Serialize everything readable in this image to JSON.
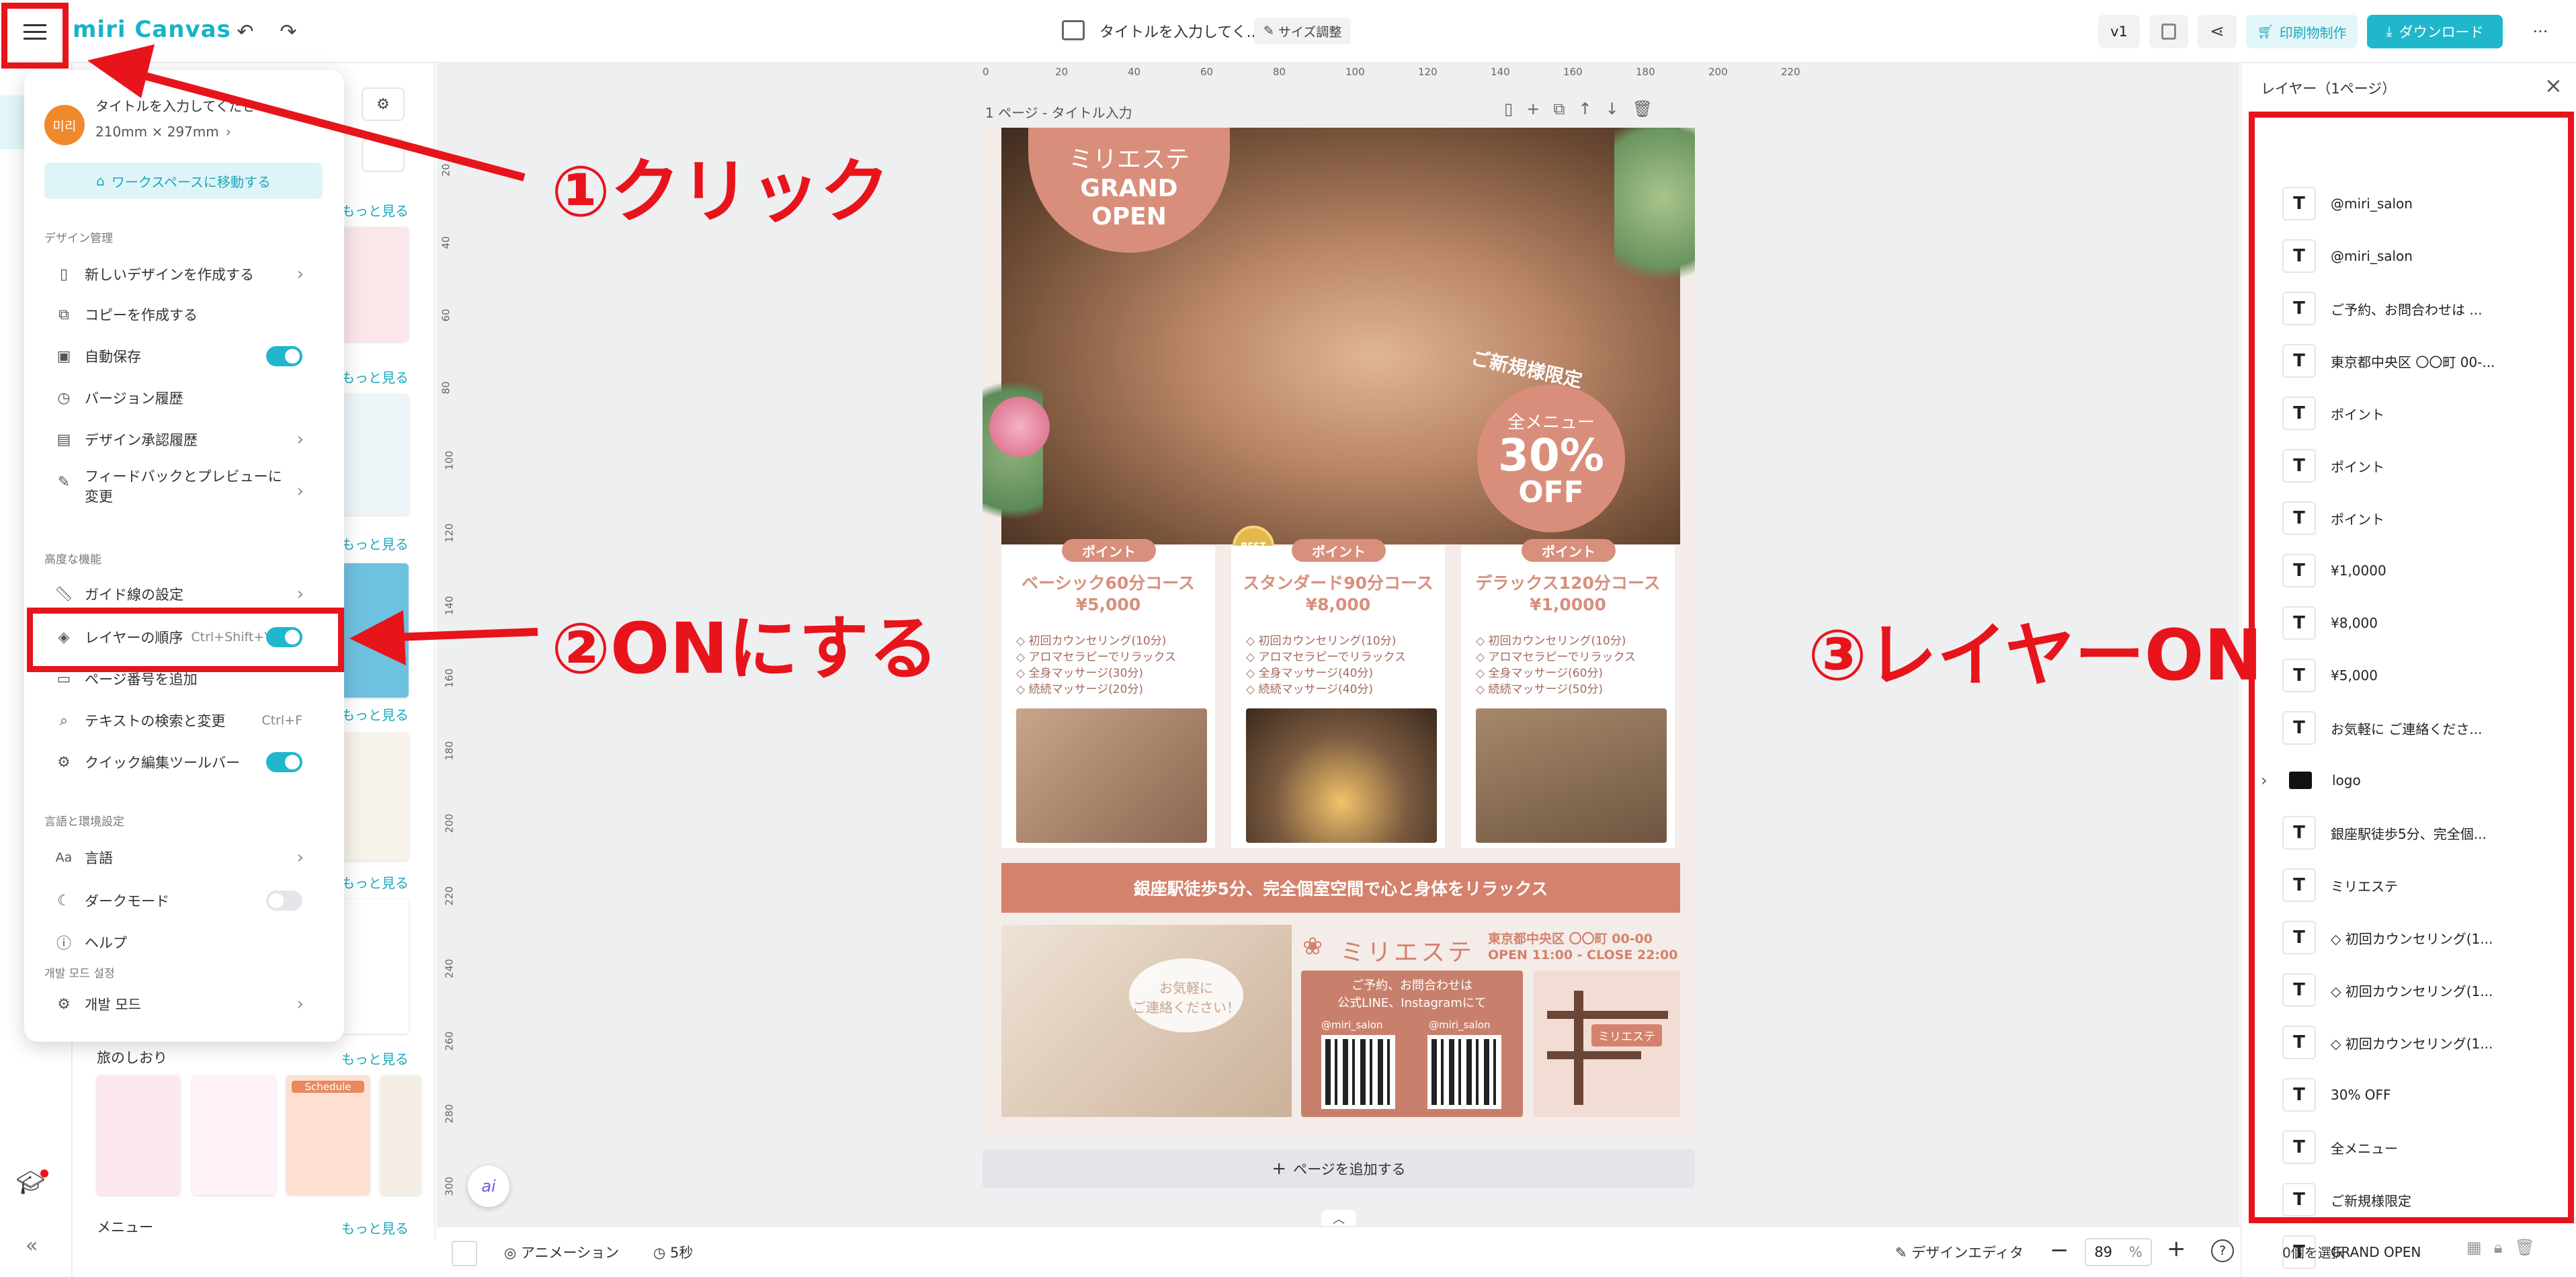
{
  "app": {
    "logo": "miri Canvas"
  },
  "topbar": {
    "doc_title": "タイトルを入力してく...",
    "size_adjust": "サイズ調整",
    "version": "v1",
    "print_label": "印刷物制作",
    "download_label": "ダウンロード",
    "more": "···"
  },
  "menu": {
    "avatar": "미리",
    "title": "タイトルを入力してくださ",
    "size": "210mm × 297mm",
    "workspace_btn": "ワークスペースに移動する",
    "sections": {
      "design": "デザイン管理",
      "advanced": "高度な機能",
      "language": "言語と環境設定",
      "dev": "개발 모드 설정"
    },
    "items": {
      "new_design": "新しいデザインを作成する",
      "copy": "コピーを作成する",
      "autosave": "自動保存",
      "version_history": "バージョン履歴",
      "approval": "デザイン承認履歴",
      "feedback": "フィードバックとプレビューに変更",
      "guides": "ガイド線の設定",
      "layer_order": "レイヤーの順序",
      "layer_shortcut": "Ctrl+Shift+Y",
      "page_number": "ページ番号を追加",
      "find_replace": "テキストの検索と変更",
      "find_shortcut": "Ctrl+F",
      "quick_toolbar": "クイック編集ツールバー",
      "language": "言語",
      "dark_mode": "ダークモード",
      "help": "ヘルプ",
      "dev_mode": "개발 모드"
    },
    "toggles": {
      "autosave": true,
      "layer_order": true,
      "quick_toolbar": true,
      "dark_mode": false
    }
  },
  "sidepanel": {
    "more": "もっと見る",
    "section_travel": "旅のしおり",
    "section_menu": "メニュー",
    "thumb_texts": {
      "schedule": "Schedule"
    }
  },
  "canvas": {
    "page_label": "1 ページ - タイトル入力",
    "add_page": "ページを追加する",
    "ruler_top": [
      "0",
      "20",
      "40",
      "60",
      "80",
      "100",
      "120",
      "140",
      "160",
      "180",
      "200",
      "220"
    ],
    "ruler_left": [
      "20",
      "40",
      "60",
      "80",
      "100",
      "120",
      "140",
      "160",
      "180",
      "200",
      "220",
      "240",
      "260",
      "280",
      "300"
    ]
  },
  "poster": {
    "brand": "ミリエステ",
    "grand_open": "GRAND\nOPEN",
    "new_limited": "ご新規様限定",
    "all_menu": "全メニュー",
    "discount": "30%",
    "off": "OFF",
    "point": "ポイント",
    "best": "BEST",
    "courses": [
      {
        "title": "ベーシック60分コース",
        "price": "¥5,000",
        "items": [
          "◇ 初回カウンセリング(10分)",
          "◇ アロマセラピーでリラックス",
          "◇ 全身マッサージ(30分)",
          "◇ 続続マッサージ(20分)"
        ]
      },
      {
        "title": "スタンダード90分コース",
        "price": "¥8,000",
        "items": [
          "◇ 初回カウンセリング(10分)",
          "◇ アロマセラピーでリラックス",
          "◇ 全身マッサージ(40分)",
          "◇ 続続マッサージ(40分)"
        ]
      },
      {
        "title": "デラックス120分コース",
        "price": "¥1,0000",
        "items": [
          "◇ 初回カウンセリング(10分)",
          "◇ アロマセラピーでリラックス",
          "◇ 全身マッサージ(60分)",
          "◇ 続続マッサージ(50分)"
        ]
      }
    ],
    "banner": "銀座駅徒歩5分、完全個室空間で心と身体をリラックス",
    "address": "東京都中央区 〇〇町 00-00",
    "hours": "OPEN 11:00 - CLOSE 22:00",
    "contact_bubble": "お気軽に\nご連絡ください！",
    "contact_title": "ご予約、お問合わせは\n公式LINE、Instagramにて",
    "handle": "@miri_salon",
    "map_label": "ミリエステ"
  },
  "layers": {
    "title": "レイヤー（1ページ）",
    "items": [
      {
        "type": "T",
        "label": "@miri_salon"
      },
      {
        "type": "T",
        "label": "@miri_salon"
      },
      {
        "type": "T",
        "label": "ご予約、お問合わせは ..."
      },
      {
        "type": "T",
        "label": "東京都中央区 〇〇町 00-..."
      },
      {
        "type": "T",
        "label": "ポイント"
      },
      {
        "type": "T",
        "label": "ポイント"
      },
      {
        "type": "T",
        "label": "ポイント"
      },
      {
        "type": "T",
        "label": "¥1,0000"
      },
      {
        "type": "T",
        "label": "¥8,000"
      },
      {
        "type": "T",
        "label": "¥5,000"
      },
      {
        "type": "T",
        "label": "お気軽に ご連絡くださ..."
      },
      {
        "type": "folder",
        "label": "logo"
      },
      {
        "type": "T",
        "label": "銀座駅徒歩5分、完全個..."
      },
      {
        "type": "T",
        "label": "ミリエステ"
      },
      {
        "type": "T",
        "label": "◇ 初回カウンセリング(1..."
      },
      {
        "type": "T",
        "label": "◇ 初回カウンセリング(1..."
      },
      {
        "type": "T",
        "label": "◇ 初回カウンセリング(1..."
      },
      {
        "type": "T",
        "label": "30% OFF"
      },
      {
        "type": "T",
        "label": "全メニュー"
      },
      {
        "type": "T",
        "label": "ご新規様限定"
      },
      {
        "type": "T",
        "label": "GRAND OPEN"
      }
    ],
    "selected_count": "0個を選択"
  },
  "bottombar": {
    "animation": "アニメーション",
    "duration": "5秒",
    "design_editor": "デザインエディタ",
    "zoom": "89",
    "zoom_unit": "%"
  },
  "annotations": {
    "step1": "①クリック",
    "step2": "②ONにする",
    "step3": "③レイヤーON"
  },
  "colors": {
    "accent": "#20b7cc",
    "annotation": "#e8141b",
    "poster_accent": "#d88f7c"
  }
}
